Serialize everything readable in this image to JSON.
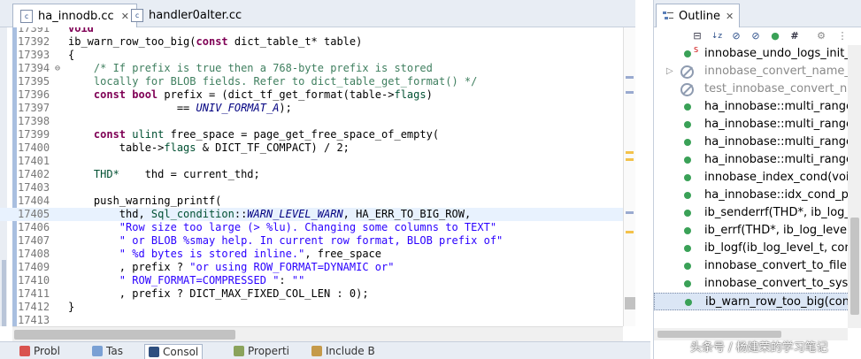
{
  "editor": {
    "tabs": [
      {
        "label": "ha_innodb.cc",
        "icon": "cpp-file-icon",
        "active": true
      },
      {
        "label": "handler0alter.cc",
        "icon": "cpp-file-icon",
        "active": false
      }
    ],
    "code_lines": [
      {
        "n": "17391",
        "fold": "",
        "hl": false,
        "segs": [
          [
            "kw",
            "void"
          ]
        ]
      },
      {
        "n": "17392",
        "fold": "",
        "hl": false,
        "segs": [
          [
            "plain",
            "ib_warn_row_too_big"
          ],
          [
            "plain",
            "("
          ],
          [
            "kw",
            "const"
          ],
          [
            "plain",
            " dict_table_t* table)"
          ]
        ]
      },
      {
        "n": "17393",
        "fold": "",
        "hl": false,
        "segs": [
          [
            "plain",
            "{"
          ]
        ]
      },
      {
        "n": "17394",
        "fold": "⊖",
        "hl": false,
        "segs": [
          [
            "cm",
            "    /* If prefix is true then a 768-byte prefix is stored"
          ]
        ]
      },
      {
        "n": "17395",
        "fold": "",
        "hl": false,
        "segs": [
          [
            "cm",
            "    locally for BLOB fields. Refer to dict_table_get_format() */"
          ]
        ]
      },
      {
        "n": "17396",
        "fold": "",
        "hl": false,
        "segs": [
          [
            "kw",
            "    const bool"
          ],
          [
            "plain",
            " prefix = (dict_tf_get_format(table->"
          ],
          [
            "ty",
            "flags"
          ],
          [
            "plain",
            ")"
          ]
        ]
      },
      {
        "n": "17397",
        "fold": "",
        "hl": false,
        "segs": [
          [
            "plain",
            "                 == "
          ],
          [
            "mc",
            "UNIV_FORMAT_A"
          ],
          [
            "plain",
            ");"
          ]
        ]
      },
      {
        "n": "17398",
        "fold": "",
        "hl": false,
        "segs": []
      },
      {
        "n": "17399",
        "fold": "",
        "hl": false,
        "segs": [
          [
            "kw",
            "    const"
          ],
          [
            "plain",
            " "
          ],
          [
            "ty",
            "ulint"
          ],
          [
            "plain",
            " free_space = page_get_free_space_of_empty("
          ]
        ]
      },
      {
        "n": "17400",
        "fold": "",
        "hl": false,
        "segs": [
          [
            "plain",
            "        table->"
          ],
          [
            "ty",
            "flags"
          ],
          [
            "plain",
            " & DICT_TF_COMPACT) / 2;"
          ]
        ]
      },
      {
        "n": "17401",
        "fold": "",
        "hl": false,
        "segs": []
      },
      {
        "n": "17402",
        "fold": "",
        "hl": false,
        "segs": [
          [
            "ty",
            "    THD*"
          ],
          [
            "plain",
            "    thd = current_thd;"
          ]
        ]
      },
      {
        "n": "17403",
        "fold": "",
        "hl": false,
        "segs": []
      },
      {
        "n": "17404",
        "fold": "",
        "hl": false,
        "segs": [
          [
            "plain",
            "    push_warning_printf("
          ]
        ]
      },
      {
        "n": "17405",
        "fold": "",
        "hl": true,
        "segs": [
          [
            "plain",
            "        thd, "
          ],
          [
            "ty",
            "Sql_condition"
          ],
          [
            "plain",
            "::"
          ],
          [
            "mc",
            "WARN_LEVEL_WARN"
          ],
          [
            "plain",
            ", HA_ERR_TO_BIG_ROW,"
          ]
        ]
      },
      {
        "n": "17406",
        "fold": "",
        "hl": false,
        "segs": [
          [
            "st",
            "        \"Row size too large (> %lu). Changing some columns to TEXT\""
          ]
        ]
      },
      {
        "n": "17407",
        "fold": "",
        "hl": false,
        "segs": [
          [
            "st",
            "        \" or BLOB %smay help. In current row format, BLOB prefix of\""
          ]
        ]
      },
      {
        "n": "17408",
        "fold": "",
        "hl": false,
        "segs": [
          [
            "st",
            "        \" %d bytes is stored inline.\""
          ],
          [
            "plain",
            ", free_space"
          ]
        ]
      },
      {
        "n": "17409",
        "fold": "",
        "hl": false,
        "segs": [
          [
            "plain",
            "        , prefix ? "
          ],
          [
            "st",
            "\"or using ROW_FORMAT=DYNAMIC or\""
          ]
        ]
      },
      {
        "n": "17410",
        "fold": "",
        "hl": false,
        "segs": [
          [
            "st",
            "        \" ROW_FORMAT=COMPRESSED \""
          ],
          [
            "plain",
            ": "
          ],
          [
            "st",
            "\"\""
          ]
        ]
      },
      {
        "n": "17411",
        "fold": "",
        "hl": false,
        "segs": [
          [
            "plain",
            "        , prefix ? DICT_MAX_FIXED_COL_LEN : 0);"
          ]
        ]
      },
      {
        "n": "17412",
        "fold": "",
        "hl": false,
        "segs": [
          [
            "plain",
            "}"
          ]
        ]
      },
      {
        "n": "17413",
        "fold": "",
        "hl": false,
        "segs": []
      }
    ]
  },
  "bottom_tabs": [
    {
      "label": "Probl",
      "active": false
    },
    {
      "label": "Tas",
      "active": false
    },
    {
      "label": "Consol",
      "active": true
    },
    {
      "label": "Properti",
      "active": false
    },
    {
      "label": "Include B",
      "active": false
    }
  ],
  "outline": {
    "title": "Outline",
    "toolbar_icons": [
      "collapse-all-icon",
      "sort-az-icon",
      "hide-fields-icon",
      "hide-static-icon",
      "hide-nonpublic-icon",
      "group-icon",
      "link-editor-icon",
      "view-menu-icon"
    ],
    "items": [
      {
        "label": "innobase_undo_logs_init_def",
        "kind": "static",
        "gray": false,
        "selected": false
      },
      {
        "label": "innobase_convert_name_test",
        "kind": "noentry",
        "gray": true,
        "selected": false,
        "expander": "▷"
      },
      {
        "label": "test_innobase_convert_name",
        "kind": "noentry",
        "gray": true,
        "selected": false
      },
      {
        "label": "ha_innobase::multi_range_re",
        "kind": "function",
        "gray": false,
        "selected": false
      },
      {
        "label": "ha_innobase::multi_range_re",
        "kind": "function",
        "gray": false,
        "selected": false
      },
      {
        "label": "ha_innobase::multi_range_re",
        "kind": "function",
        "gray": false,
        "selected": false
      },
      {
        "label": "ha_innobase::multi_range_re",
        "kind": "function",
        "gray": false,
        "selected": false
      },
      {
        "label": "innobase_index_cond(void*)",
        "kind": "function",
        "gray": false,
        "selected": false
      },
      {
        "label": "ha_innobase::idx_cond_push",
        "kind": "function",
        "gray": false,
        "selected": false
      },
      {
        "label": "ib_senderrf(THD*, ib_log_lev",
        "kind": "function",
        "gray": false,
        "selected": false
      },
      {
        "label": "ib_errf(THD*, ib_log_level_t, i",
        "kind": "function",
        "gray": false,
        "selected": false
      },
      {
        "label": "ib_logf(ib_log_level_t, const c",
        "kind": "function",
        "gray": false,
        "selected": false
      },
      {
        "label": "innobase_convert_to_filenam",
        "kind": "function",
        "gray": false,
        "selected": false
      },
      {
        "label": "innobase_convert_to_system_",
        "kind": "function",
        "gray": false,
        "selected": false
      },
      {
        "label": "ib_warn_row_too_big(const d",
        "kind": "function",
        "gray": false,
        "selected": true
      }
    ],
    "static_marker": "S"
  },
  "watermark": "头条号 / 杨建荣的学习笔记",
  "colors": {
    "keyword": "#7f0055",
    "comment": "#3f7f5f",
    "string": "#2a00ff",
    "macro": "#000080",
    "method_dot": "#3aa157",
    "highlight_line": "#e8f2fe"
  }
}
